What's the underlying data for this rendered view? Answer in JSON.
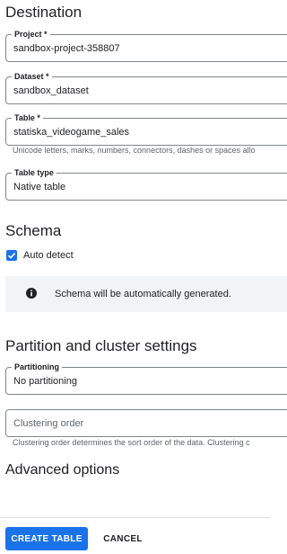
{
  "destination": {
    "heading": "Destination",
    "project": {
      "label": "Project *",
      "value": "sandbox-project-358807"
    },
    "dataset": {
      "label": "Dataset *",
      "value": "sandbox_dataset"
    },
    "table": {
      "label": "Table *",
      "value": "statiska_videogame_sales",
      "hint": "Unicode letters, marks, numbers, connectors, dashes or spaces allo"
    },
    "table_type": {
      "label": "Table type",
      "value": "Native table"
    }
  },
  "schema": {
    "heading": "Schema",
    "auto_detect_label": "Auto detect",
    "auto_detect_checked": true,
    "info_icon": "info-icon",
    "info_text": "Schema will be automatically generated."
  },
  "partition": {
    "heading": "Partition and cluster settings",
    "partitioning": {
      "label": "Partitioning",
      "value": "No partitioning"
    },
    "clustering": {
      "placeholder": "Clustering order",
      "hint": "Clustering order determines the sort order of the data. Clustering c"
    }
  },
  "advanced": {
    "heading": "Advanced options"
  },
  "actions": {
    "create_label": "CREATE TABLE",
    "cancel_label": "CANCEL"
  },
  "colors": {
    "accent": "#1a73e8",
    "info_bg": "#f1f3f4",
    "border": "#80868b"
  }
}
